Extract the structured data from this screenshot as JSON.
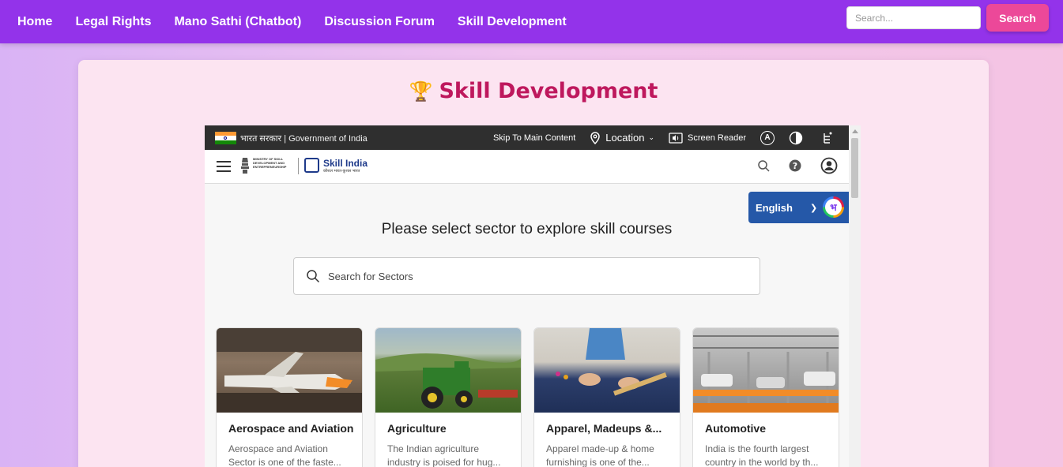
{
  "navbar": {
    "links": [
      "Home",
      "Legal Rights",
      "Mano Sathi (Chatbot)",
      "Discussion Forum",
      "Skill Development"
    ],
    "search_placeholder": "Search...",
    "search_button": "Search"
  },
  "page": {
    "title": "Skill Development",
    "title_icon": "trophy-icon"
  },
  "embed": {
    "gov_bar": {
      "hindi_text": "भारत सरकार",
      "english_text": "Government of India",
      "skip_link": "Skip To Main Content",
      "location_label": "Location",
      "screen_reader_label": "Screen Reader",
      "font_size_label": "A"
    },
    "header": {
      "logo_name": "Skill India",
      "logo_tagline": "कौशल भारत-कुशल भारत",
      "ministry_text": "MINISTRY OF SKILL DEVELOPMENT AND ENTREPRENEURSHIP"
    },
    "language": {
      "selected": "English",
      "bhashini_glyph": "भ"
    },
    "sector_heading": "Please select sector to explore skill courses",
    "sector_search_placeholder": "Search for Sectors",
    "sectors": [
      {
        "name": "Aerospace and Aviation",
        "desc_line1": "Aerospace and Aviation",
        "desc_line2": "Sector is one of the faste..."
      },
      {
        "name": "Agriculture",
        "desc_line1": "The Indian agriculture",
        "desc_line2": "industry is poised for hug..."
      },
      {
        "name": "Apparel, Madeups &...",
        "desc_line1": "Apparel made-up & home",
        "desc_line2": "furnishing is one of the..."
      },
      {
        "name": "Automotive",
        "desc_line1": "India is the fourth largest",
        "desc_line2": "country in the world by th..."
      }
    ]
  },
  "colors": {
    "navbar": "#9333ea",
    "search_button": "#ec4899",
    "title": "#be185d",
    "language_box": "#2558a8"
  }
}
